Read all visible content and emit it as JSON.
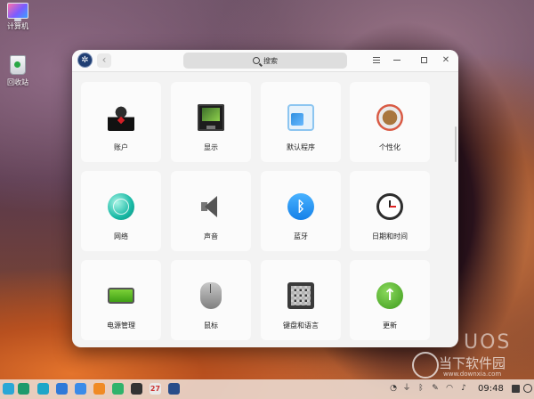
{
  "desktop": {
    "icons": [
      {
        "label": "计算机"
      },
      {
        "label": "回收站"
      }
    ]
  },
  "window": {
    "search": {
      "placeholder": "搜索"
    },
    "modules": [
      {
        "label": "账户",
        "icon": "account-icon"
      },
      {
        "label": "显示",
        "icon": "display-icon"
      },
      {
        "label": "默认程序",
        "icon": "default-apps-icon"
      },
      {
        "label": "个性化",
        "icon": "personalization-icon"
      },
      {
        "label": "网络",
        "icon": "network-icon"
      },
      {
        "label": "声音",
        "icon": "sound-icon"
      },
      {
        "label": "蓝牙",
        "icon": "bluetooth-icon"
      },
      {
        "label": "日期和时间",
        "icon": "clock-icon"
      },
      {
        "label": "电源管理",
        "icon": "battery-icon"
      },
      {
        "label": "鼠标",
        "icon": "mouse-icon"
      },
      {
        "label": "键盘和语言",
        "icon": "keyboard-icon"
      },
      {
        "label": "更新",
        "icon": "update-icon"
      }
    ]
  },
  "taskbar": {
    "apps": [
      "launcher-icon",
      "multitask-icon",
      "file-manager-icon",
      "app-store-icon",
      "browser-icon",
      "music-icon",
      "contacts-icon",
      "video-icon",
      "calendar-icon",
      "settings-icon"
    ],
    "calendar_day": "27",
    "clock": "09:48"
  },
  "watermark": {
    "brand": "UOS",
    "site": "当下软件园",
    "url": "www.downxia.com"
  },
  "colors": {
    "accent": "#1480e8",
    "update": "#3c9a1b",
    "window_bg": "#f3f3f3"
  }
}
